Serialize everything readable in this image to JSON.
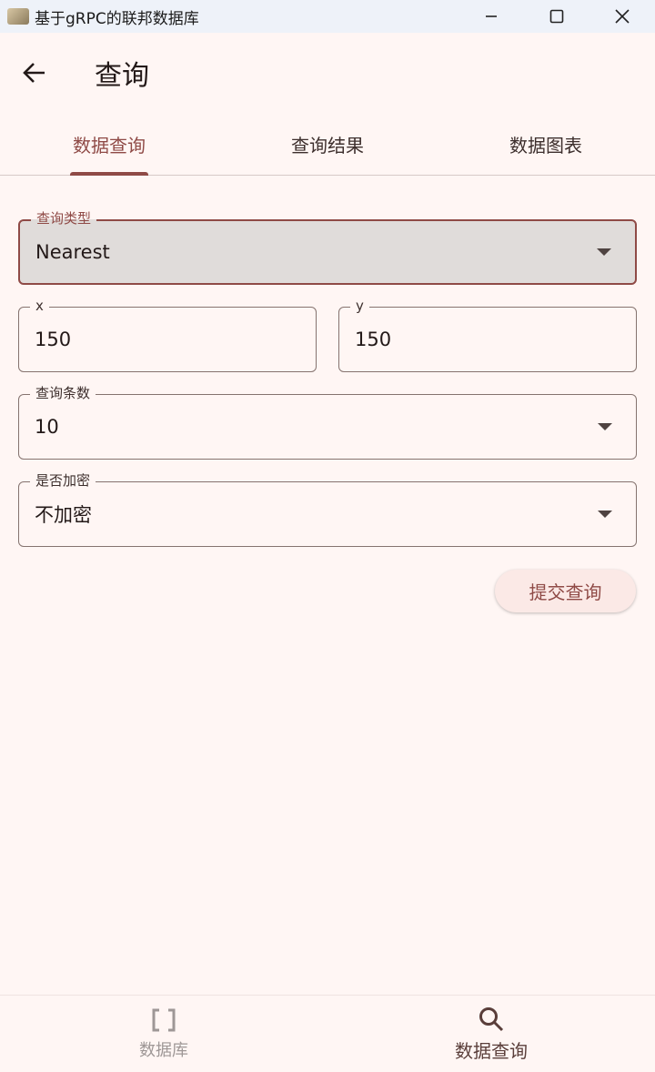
{
  "window": {
    "title": "基于gRPC的联邦数据库",
    "icon": "app-icon",
    "controls": [
      "minimize-icon",
      "maximize-icon",
      "close-icon"
    ]
  },
  "appbar": {
    "back_icon": "arrow-left-icon",
    "title": "查询"
  },
  "tabs": [
    {
      "label": "数据查询",
      "active": true
    },
    {
      "label": "查询结果",
      "active": false
    },
    {
      "label": "数据图表",
      "active": false
    }
  ],
  "form": {
    "query_type": {
      "label": "查询类型",
      "value": "Nearest"
    },
    "x": {
      "label": "x",
      "value": "150"
    },
    "y": {
      "label": "y",
      "value": "150"
    },
    "count": {
      "label": "查询条数",
      "value": "10"
    },
    "encrypt": {
      "label": "是否加密",
      "value": "不加密"
    },
    "submit_label": "提交查询"
  },
  "bottom_nav": [
    {
      "label": "数据库",
      "icon": "brackets-icon",
      "active": false
    },
    {
      "label": "数据查询",
      "icon": "search-icon",
      "active": true
    }
  ],
  "colors": {
    "primary": "#8f4a46",
    "background": "#fff6f4",
    "focused_fill": "#e0dcda",
    "outline": "#85736f"
  }
}
